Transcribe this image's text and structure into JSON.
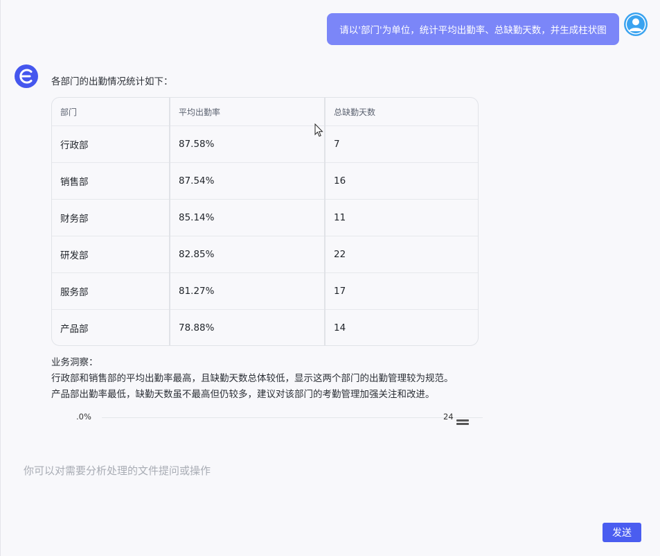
{
  "user_message": {
    "text": "请以'部门'为单位，统计平均出勤率、总缺勤天数，并生成柱状图",
    "avatar_icon": "user-icon"
  },
  "assistant": {
    "avatar_icon": "app-logo-icon",
    "intro": "各部门的出勤情况统计如下：",
    "table": {
      "headers": [
        "部门",
        "平均出勤率",
        "总缺勤天数"
      ],
      "rows": [
        [
          "行政部",
          "87.58%",
          "7"
        ],
        [
          "销售部",
          "87.54%",
          "16"
        ],
        [
          "财务部",
          "85.14%",
          "11"
        ],
        [
          "研发部",
          "82.85%",
          "22"
        ],
        [
          "服务部",
          "81.27%",
          "17"
        ],
        [
          "产品部",
          "78.88%",
          "14"
        ]
      ]
    },
    "insight": {
      "title": "业务洞察：",
      "lines": [
        "行政部和销售部的平均出勤率最高，且缺勤天数总体较低，显示这两个部门的出勤管理较为规范。",
        "产品部出勤率最低，缺勤天数虽不最高但仍较多，建议对该部门的考勤管理加强关注和改进。"
      ]
    },
    "chart_strip": {
      "left_label": ".0%",
      "right_label": "24",
      "menu_icon": "menu-icon"
    }
  },
  "composer": {
    "placeholder": "你可以对需要分析处理的文件提问或操作",
    "send_label": "发送"
  },
  "colors": {
    "user_bubble": "#7b86f8",
    "accent": "#4a5df0",
    "avatar_user": "#3aa3f0",
    "background": "#f8f8fb"
  }
}
